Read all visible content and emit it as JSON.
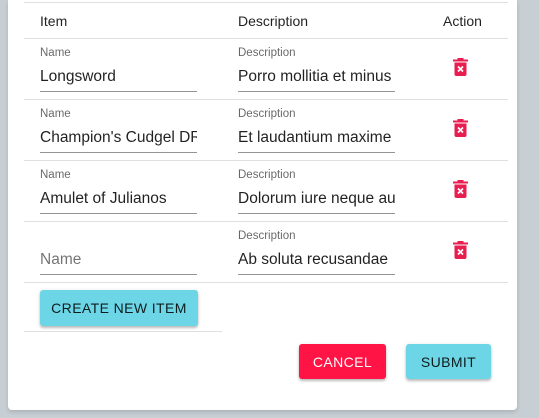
{
  "table": {
    "headers": {
      "item": "Item",
      "description": "Description",
      "action": "Action"
    },
    "rows": [
      {
        "name_label": "Name",
        "name_value": "Longsword",
        "desc_label": "Description",
        "desc_value": "Porro mollitia et minus"
      },
      {
        "name_label": "Name",
        "name_value": "Champion's Cudgel DR",
        "desc_label": "Description",
        "desc_value": "Et laudantium maxime"
      },
      {
        "name_label": "Name",
        "name_value": "Amulet of Julianos",
        "desc_label": "Description",
        "desc_value": "Dolorum iure neque au"
      },
      {
        "name_placeholder": "Name",
        "desc_label": "Description",
        "desc_value": "Ab soluta recusandae"
      }
    ]
  },
  "actions": {
    "create_label": "CREATE NEW ITEM",
    "cancel_label": "CANCEL",
    "submit_label": "SUBMIT"
  },
  "colors": {
    "accent_cyan": "#6dd6e6",
    "danger_red": "#ff1445",
    "delete_icon": "#e91e50"
  },
  "icons": {
    "delete": "delete-forever-icon"
  }
}
